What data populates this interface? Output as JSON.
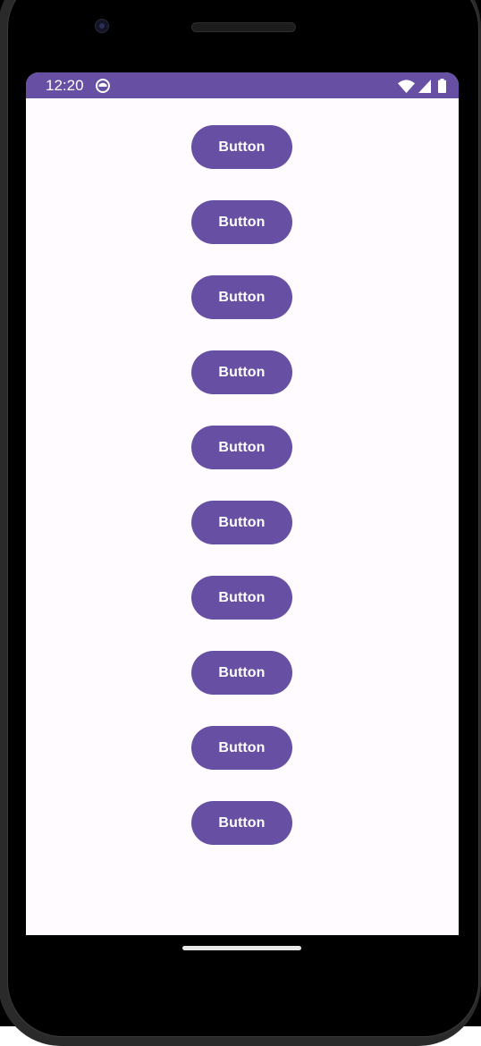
{
  "status_bar": {
    "time": "12:20",
    "background": "#6750a4",
    "left_icons": [
      "app-notification-icon"
    ],
    "right_icons": [
      "wifi-icon",
      "cellular-signal-icon",
      "battery-icon"
    ]
  },
  "screen": {
    "background": "#fffbfe"
  },
  "buttons": [
    {
      "label": "Button"
    },
    {
      "label": "Button"
    },
    {
      "label": "Button"
    },
    {
      "label": "Button"
    },
    {
      "label": "Button"
    },
    {
      "label": "Button"
    },
    {
      "label": "Button"
    },
    {
      "label": "Button"
    },
    {
      "label": "Button"
    },
    {
      "label": "Button"
    }
  ],
  "colors": {
    "accent": "#6750a4",
    "on_accent": "#ffffff",
    "device_frame": "#000000"
  },
  "device": {
    "hardware": [
      "front-camera-icon",
      "earpiece-speaker"
    ],
    "navigation": "gesture-home-handle"
  }
}
